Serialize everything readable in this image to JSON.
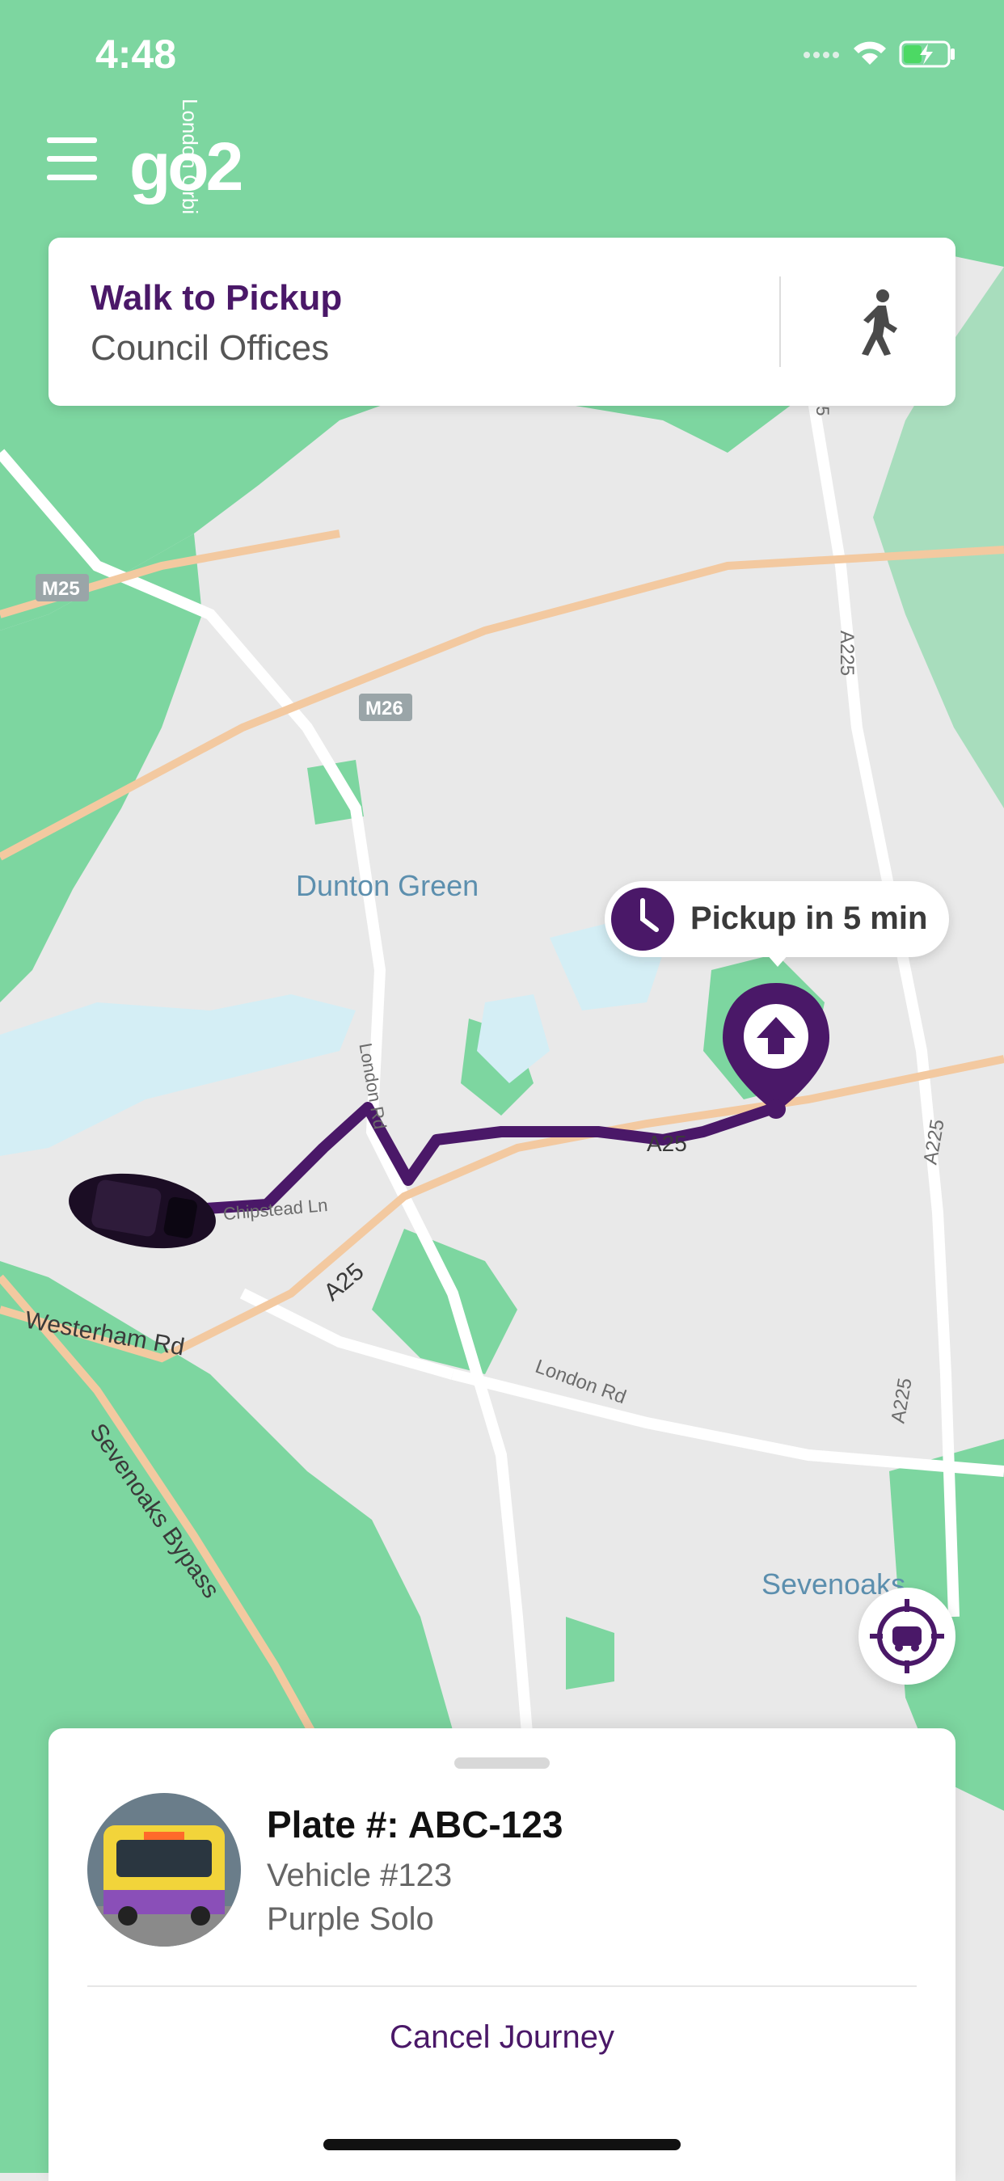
{
  "status_bar": {
    "time": "4:48"
  },
  "app": {
    "logo_text": "go2"
  },
  "walk_card": {
    "title": "Walk to Pickup",
    "subtitle": "Council Offices",
    "icon": "walking-person-icon"
  },
  "map": {
    "labels": {
      "dunton_green": "Dunton Green",
      "sevenoaks": "Sevenoaks",
      "m25": "M25",
      "m26": "M26",
      "a25_a": "A25",
      "a25_b": "A25",
      "a225_a": "A225",
      "a225_b": "A225",
      "a225_c": "A225",
      "london_rd_a": "London Rd",
      "london_rd_b": "London Rd",
      "chipstead_ln": "Chipstead Ln",
      "westerham_rd": "Westerham Rd",
      "sevenoaks_bypass": "Sevenoaks Bypass",
      "london_orbital": "London Orbi",
      "a25_top": "25"
    },
    "pickup_bubble": "Pickup in 5 min",
    "colors": {
      "green": "#7dd6a0",
      "route": "#4a1868",
      "road_orange": "#f3c9a0"
    }
  },
  "bottom_sheet": {
    "plate": "Plate #: ABC-123",
    "vehicle_number": "Vehicle #123",
    "vehicle_name": "Purple Solo",
    "cancel_label": "Cancel Journey"
  }
}
